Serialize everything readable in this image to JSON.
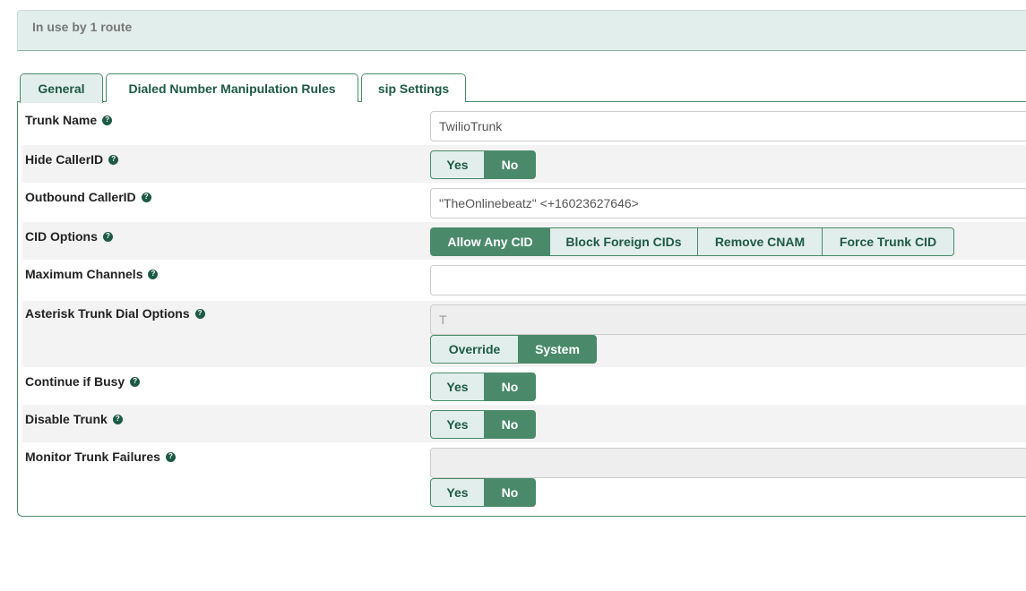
{
  "banner": {
    "text": "In use by 1 route"
  },
  "tabs": [
    {
      "label": "General"
    },
    {
      "label": "Dialed Number Manipulation Rules"
    },
    {
      "label": "sip Settings"
    }
  ],
  "fields": {
    "trunk_name": {
      "label": "Trunk Name",
      "value": "TwilioTrunk"
    },
    "hide_callerid": {
      "label": "Hide CallerID",
      "yes": "Yes",
      "no": "No",
      "selected": "No"
    },
    "outbound_callerid": {
      "label": "Outbound CallerID",
      "value": "\"TheOnlinebeatz\" <+16023627646>"
    },
    "cid_options": {
      "label": "CID Options",
      "options": [
        "Allow Any CID",
        "Block Foreign CIDs",
        "Remove CNAM",
        "Force Trunk CID"
      ],
      "selected": "Allow Any CID"
    },
    "max_channels": {
      "label": "Maximum Channels",
      "value": ""
    },
    "dial_options": {
      "label": "Asterisk Trunk Dial Options",
      "value": "T",
      "override": "Override",
      "system": "System",
      "selected": "System"
    },
    "continue_busy": {
      "label": "Continue if Busy",
      "yes": "Yes",
      "no": "No",
      "selected": "No"
    },
    "disable_trunk": {
      "label": "Disable Trunk",
      "yes": "Yes",
      "no": "No",
      "selected": "No"
    },
    "monitor_failures": {
      "label": "Monitor Trunk Failures",
      "value": "",
      "yes": "Yes",
      "no": "No",
      "selected": "No"
    }
  },
  "help_icon": "question-circle-icon",
  "colors": {
    "accent": "#4a8a6b",
    "accent_light": "#e2eeeb",
    "text_accent": "#1d5a44"
  }
}
